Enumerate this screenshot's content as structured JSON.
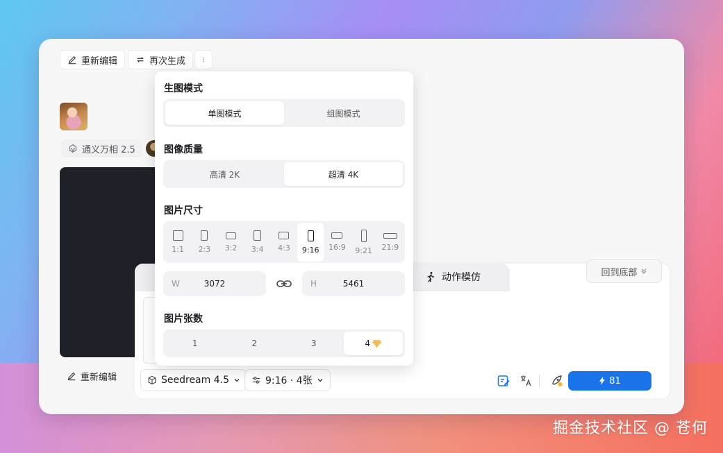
{
  "toolbar": {
    "re_edit": "重新编辑",
    "regenerate": "再次生成"
  },
  "model_chip": "通义万相 2.5",
  "bottom_re_edit": "重新编辑",
  "composer": {
    "tab_action": "动作模仿",
    "back_to_bottom": "回到底部",
    "model_select": "Seedream 4.5",
    "params_select": "9:16 · 4张",
    "send_count": "81"
  },
  "popup": {
    "mode": {
      "title": "生图模式",
      "options": [
        "单图模式",
        "组图模式"
      ],
      "selected": 0
    },
    "quality": {
      "title": "图像质量",
      "options": [
        "高清 2K",
        "超清 4K"
      ],
      "selected": 1
    },
    "size": {
      "title": "图片尺寸",
      "ratios": [
        "1:1",
        "2:3",
        "3:2",
        "3:4",
        "4:3",
        "9:16",
        "16:9",
        "9:21",
        "21:9"
      ],
      "selected": 5,
      "width_label": "W",
      "width_value": "3072",
      "height_label": "H",
      "height_value": "5461"
    },
    "count": {
      "title": "图片张数",
      "options": [
        "1",
        "2",
        "3",
        "4"
      ],
      "selected": 3
    }
  },
  "watermark": "掘金技术社区 @ 苍何",
  "colors": {
    "accent": "#1a73e8",
    "dark_preview": "#1e2127"
  }
}
